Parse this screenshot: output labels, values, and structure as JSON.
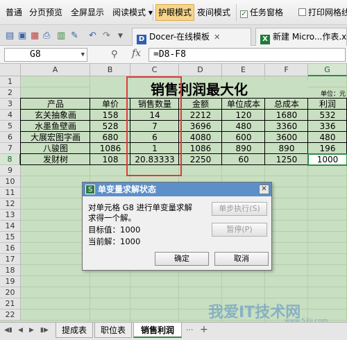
{
  "ribbon": {
    "items": [
      "普通",
      "分页预览",
      "全屏显示",
      "阅读模式 ▾",
      "护眼模式",
      "夜间模式"
    ],
    "active": "护眼模式",
    "checkboxes": [
      {
        "label": "任务窗格",
        "checked": true
      },
      {
        "label": "打印网格线",
        "checked": false
      }
    ]
  },
  "tabs": [
    {
      "label": "Docer-在线模板",
      "icon": "D"
    },
    {
      "label": "新建 Micro...作表.x",
      "icon": "X"
    }
  ],
  "formula_bar": {
    "cell": "G8",
    "formula": "=D8-F8"
  },
  "columns": [
    "A",
    "B",
    "C",
    "D",
    "E",
    "F",
    "G"
  ],
  "selected_column": "G",
  "rows": [
    "1",
    "2",
    "3",
    "4",
    "5",
    "6",
    "7",
    "8",
    "9",
    "10",
    "11",
    "12",
    "13",
    "14",
    "15",
    "16",
    "17",
    "18",
    "19",
    "20",
    "21",
    "22"
  ],
  "selected_row": "8",
  "sheet": {
    "title": "销售利润最大化",
    "unit_note": "单位：元",
    "headers": [
      "产品",
      "单价",
      "销售数量",
      "金额",
      "单位成本",
      "总成本",
      "利润"
    ],
    "data": [
      [
        "玄关抽象画",
        "158",
        "14",
        "2212",
        "120",
        "1680",
        "532"
      ],
      [
        "水墨鱼壁画",
        "528",
        "7",
        "3696",
        "480",
        "3360",
        "336"
      ],
      [
        "大展宏图字画",
        "680",
        "6",
        "4080",
        "600",
        "3600",
        "480"
      ],
      [
        "八骏图",
        "1086",
        "1",
        "1086",
        "890",
        "890",
        "196"
      ],
      [
        "发财树",
        "108",
        "20.83333",
        "2250",
        "60",
        "1250",
        "1000"
      ]
    ]
  },
  "dialog": {
    "title": "单变量求解状态",
    "logo": "S",
    "line1": "对单元格 G8 进行单变量求解",
    "line2": "求得一个解。",
    "target_label": "目标值：1000",
    "current_label": "当前解：1000",
    "step_button": "单步执行(S)",
    "pause_button": "暂停(P)",
    "ok_button": "确定",
    "cancel_button": "取消"
  },
  "sheet_tabs": [
    "提成表",
    "职位表",
    "销售利润"
  ],
  "active_sheet": "销售利润",
  "watermark": {
    "main": "我爱IT技术网",
    "sub": "www.52ij.com"
  },
  "colors": {
    "accent": "#2d8a46",
    "highlight": "#e03a3a",
    "eye_bg": "#c9dfc1",
    "dialog_title": "#5d8fc9"
  }
}
